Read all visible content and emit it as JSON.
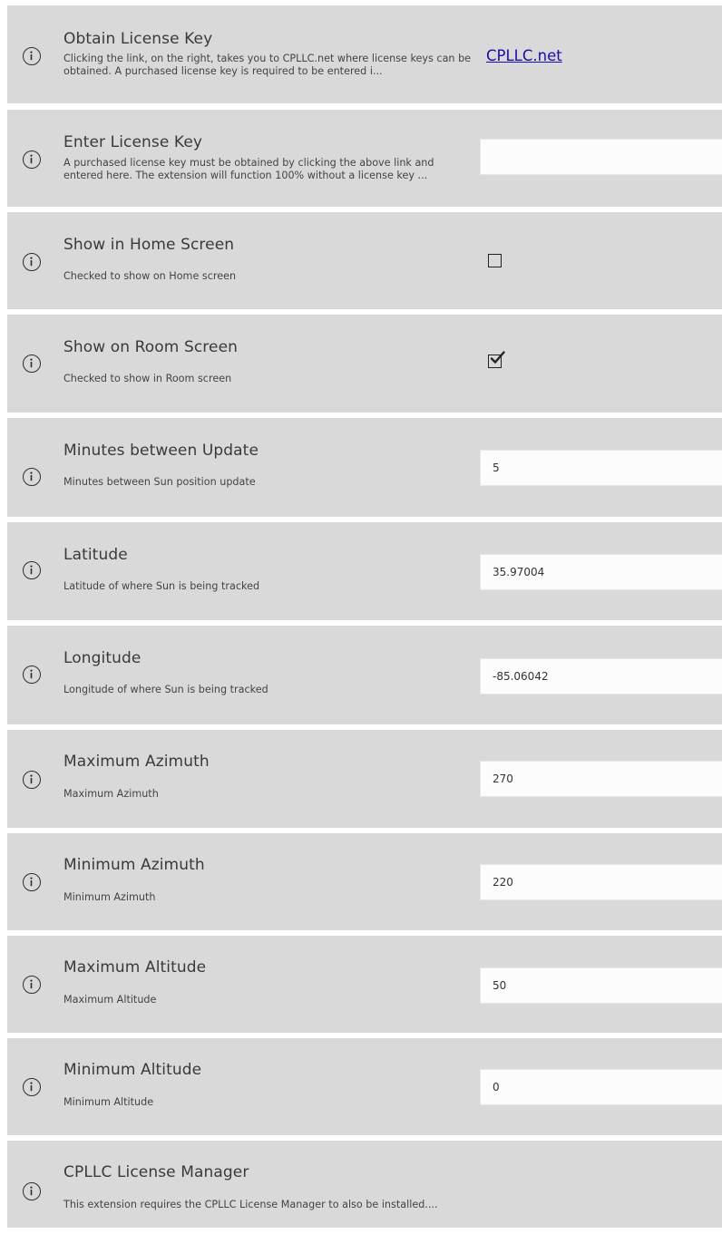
{
  "settings": [
    {
      "id": "obtain-license-key",
      "title": "Obtain License Key",
      "description": "Clicking the link, on the right, takes you to CPLLC.net where license keys can be obtained.  A purchased license key is required to be entered i...",
      "control": "link",
      "link_text": "CPLLC.net"
    },
    {
      "id": "enter-license-key",
      "title": "Enter License Key",
      "description": "A purchased license key must be obtained by clicking the above link and entered here. The extension will function 100% without a license key ...",
      "control": "text",
      "value": ""
    },
    {
      "id": "show-in-home-screen",
      "title": "Show in Home Screen",
      "description": "Checked to show on Home screen",
      "control": "checkbox",
      "checked": false
    },
    {
      "id": "show-on-room-screen",
      "title": "Show on Room Screen",
      "description": "Checked to show in Room screen",
      "control": "checkbox",
      "checked": true
    },
    {
      "id": "minutes-between-update",
      "title": "Minutes between Update",
      "description": "Minutes between Sun position update",
      "control": "text",
      "value": "5"
    },
    {
      "id": "latitude",
      "title": "Latitude",
      "description": "Latitude of where Sun is being tracked",
      "control": "text",
      "value": "35.97004"
    },
    {
      "id": "longitude",
      "title": "Longitude",
      "description": "Longitude of where Sun is being tracked",
      "control": "text",
      "value": "-85.06042"
    },
    {
      "id": "maximum-azimuth",
      "title": "Maximum Azimuth",
      "description": "Maximum Azimuth",
      "control": "text",
      "value": "270"
    },
    {
      "id": "minimum-azimuth",
      "title": "Minimum Azimuth",
      "description": "Minimum Azimuth",
      "control": "text",
      "value": "220"
    },
    {
      "id": "maximum-altitude",
      "title": "Maximum Altitude",
      "description": "Maximum Altitude",
      "control": "text",
      "value": "50"
    },
    {
      "id": "minimum-altitude",
      "title": "Minimum Altitude",
      "description": "Minimum Altitude",
      "control": "text",
      "value": "0"
    },
    {
      "id": "cpllc-license-manager",
      "title": "CPLLC License Manager",
      "description": "This extension requires the CPLLC License Manager to also be installed....",
      "control": "none"
    }
  ],
  "icon": "info-icon",
  "colors": {
    "row_background": "#d9d9d9",
    "page_background": "#ffffff",
    "link": "#1a0dab",
    "field_background": "#fcfcfc"
  }
}
